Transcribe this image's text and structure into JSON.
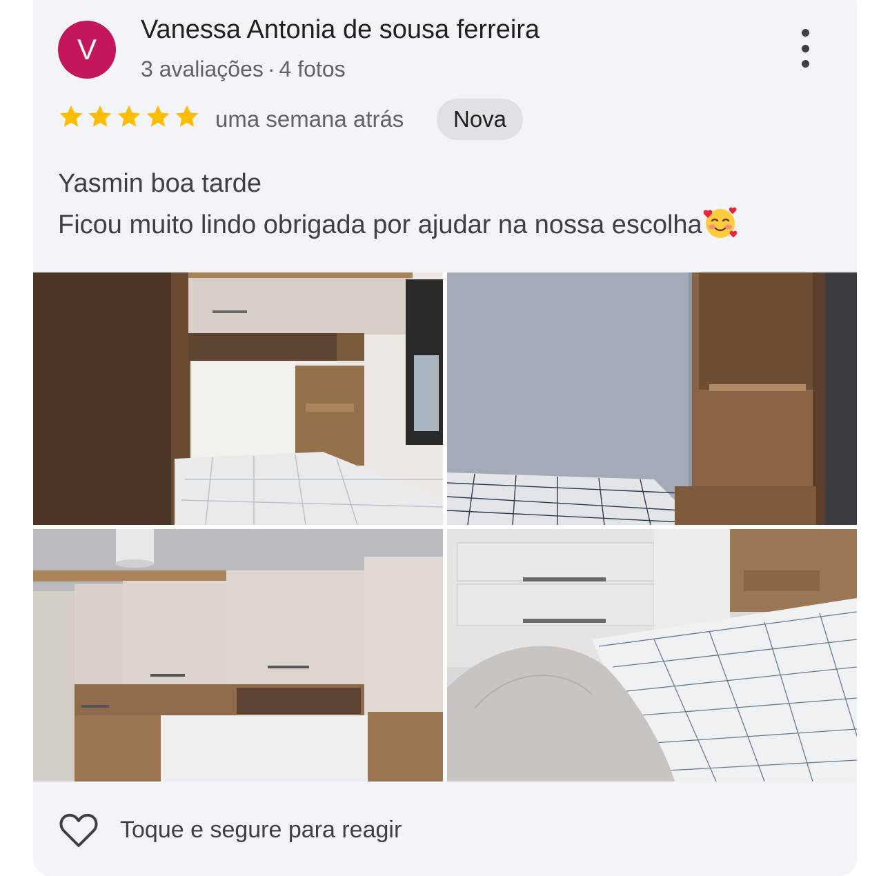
{
  "reviewer": {
    "initial": "V",
    "name": "Vanessa Antonia de sousa ferreira",
    "review_count": "3 avaliações",
    "separator": "·",
    "photo_count": "4 fotos",
    "avatar_color": "#c2185b"
  },
  "rating": {
    "stars": 5,
    "max": 5,
    "star_color": "#fbbc04"
  },
  "date": "uma semana atrás",
  "badge": "Nova",
  "review_lines": [
    "Yasmin boa tarde",
    "Ficou muito lindo obrigada por ajudar na nossa escolha"
  ],
  "emoji": "smiling-face-with-hearts",
  "photos": [
    {
      "id": "bedroom-photo-1"
    },
    {
      "id": "bedroom-photo-2"
    },
    {
      "id": "bedroom-photo-3"
    },
    {
      "id": "bedroom-photo-4"
    }
  ],
  "reaction": {
    "icon": "heart-icon",
    "label": "Toque e segure para reagir"
  }
}
